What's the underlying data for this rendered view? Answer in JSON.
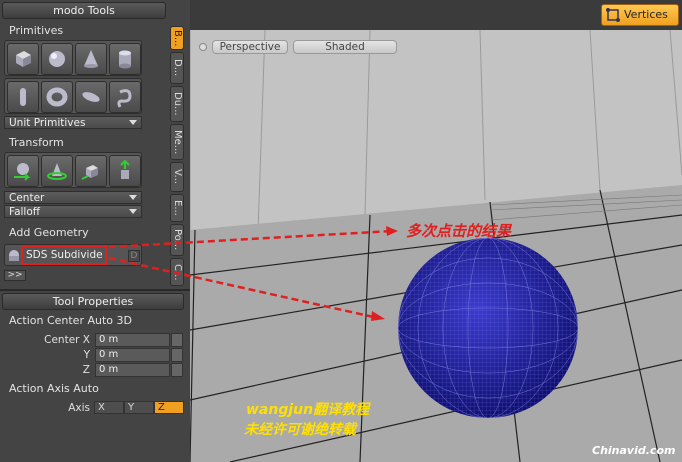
{
  "panel": {
    "title": "modo Tools",
    "primitives_label": "Primitives",
    "unit_primitives": "Unit Primitives",
    "transform_label": "Transform",
    "center": "Center",
    "falloff": "Falloff",
    "add_geometry_label": "Add Geometry",
    "sds_subdivide": "SDS Subdivide",
    "sds_key": "D",
    "more": ">>",
    "tool_properties": "Tool Properties",
    "action_center": "Action Center Auto 3D",
    "center_x_label": "Center X",
    "y_label": "Y",
    "z_label": "Z",
    "center_x_value": "0 m",
    "y_value": "0 m",
    "z_value": "0 m",
    "action_axis": "Action Axis Auto",
    "axis_label": "Axis",
    "axis_x": "X",
    "axis_y": "Y",
    "axis_z": "Z"
  },
  "side_tabs": [
    "B...",
    "D...",
    "Du...",
    "Me...",
    "V...",
    "E...",
    "Po...",
    "C..."
  ],
  "viewport": {
    "perspective": "Perspective",
    "shaded": "Shaded",
    "selection_mode": "Vertices"
  },
  "annotations": {
    "result_text": "多次点击的结果",
    "credit_line1": "wangjun翻译教程",
    "credit_line2": "未经许可谢绝转载",
    "watermark": "Chinavid.com"
  },
  "colors": {
    "accent_orange": "#f0a020",
    "annotation_red": "#e02020",
    "credit_yellow": "#ffe000",
    "sphere_blue": "#1a1a90"
  }
}
